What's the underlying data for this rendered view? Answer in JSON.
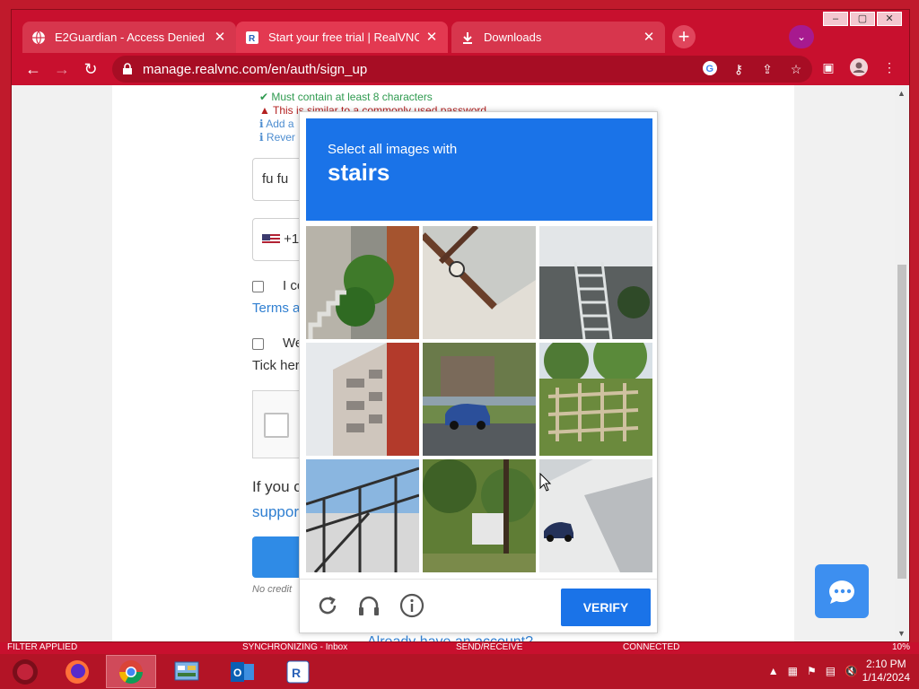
{
  "browser": {
    "tabs": [
      {
        "title": "E2Guardian - Access Denied",
        "icon": "globe-icon",
        "active": false
      },
      {
        "title": "Start your free trial | RealVNC Co",
        "icon": "realvnc-icon",
        "active": true
      },
      {
        "title": "Downloads",
        "icon": "download-icon",
        "active": false
      }
    ],
    "url": "manage.realvnc.com/en/auth/sign_up"
  },
  "form": {
    "requirements": [
      {
        "text": "Must contain at least 8 characters",
        "status": "ok"
      },
      {
        "text": "This is similar to a commonly used password",
        "status": "warn"
      },
      {
        "text": "Add a",
        "status": "info"
      },
      {
        "text": "Rever",
        "status": "info"
      }
    ],
    "name_value": "fu fu",
    "phone_prefix": "+1",
    "consent_text": "I con",
    "terms_link": "Terms a",
    "marketing_text": "We'd",
    "tick_text": "Tick her",
    "support_prefix": "If you c",
    "support_link": "suppor",
    "no_credit": "No credit",
    "already_account": "Already have an account?"
  },
  "captcha": {
    "instruction": "Select all images with",
    "keyword": "stairs",
    "verify_label": "VERIFY",
    "tiles": [
      "outdoor stairs beside building with tree",
      "house roof corner",
      "metal stairs under balcony",
      "apartment building facade",
      "street with blue car",
      "wooden structure on hillside",
      "fire escape stairs",
      "trees and car",
      "car in garage entrance"
    ]
  },
  "status_bar": {
    "left": "FILTER APPLIED",
    "sync": "SYNCHRONIZING - Inbox",
    "send": "SEND/RECEIVE",
    "connected": "CONNECTED",
    "zoom": "10%"
  },
  "taskbar": {
    "apps": [
      "start-button",
      "firefox-icon",
      "chrome-icon",
      "control-panel-icon",
      "outlook-icon",
      "realvnc-viewer-icon"
    ],
    "time": "2:10 PM",
    "date": "1/14/2024"
  },
  "colors": {
    "theme_red": "#c8102e",
    "captcha_blue": "#1a73e8"
  }
}
